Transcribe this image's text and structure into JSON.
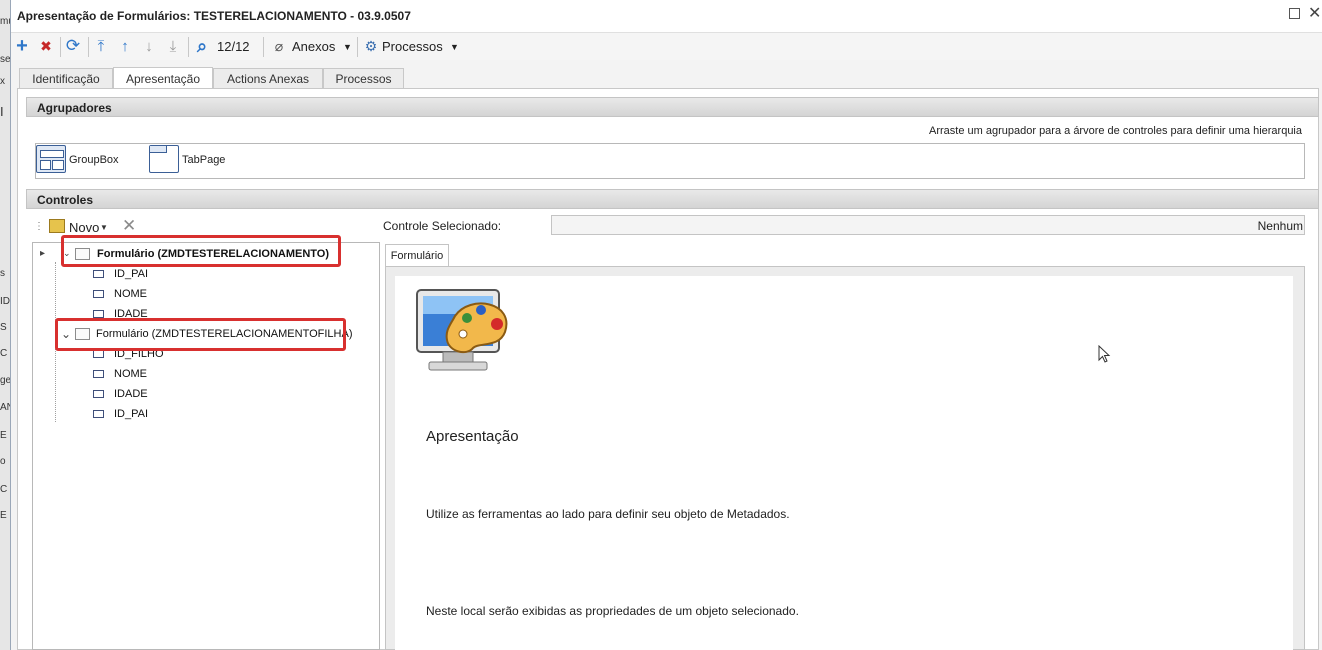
{
  "background_strip": [
    "mu",
    "se",
    "x",
    "I",
    "s",
    "ID",
    "S",
    "C",
    "ge",
    "AN",
    "E",
    "o",
    "C",
    "E"
  ],
  "window": {
    "title": "Apresentação de Formulários: TESTERELACIONAMENTO - 03.9.0507"
  },
  "toolbar": {
    "add": "+",
    "remove": "✖",
    "refresh": "⟳",
    "first": "⤒",
    "up": "↑",
    "down": "↓",
    "last": "⤓",
    "search": "⌕",
    "record_counter": "12/12",
    "attachments_label": "Anexos",
    "processes_label": "Processos",
    "dropdown": "▼"
  },
  "tabs": [
    {
      "label": "Identificação"
    },
    {
      "label": "Apresentação",
      "active": true
    },
    {
      "label": "Actions Anexas"
    },
    {
      "label": "Processos"
    }
  ],
  "agrupadores": {
    "header": "Agrupadores",
    "hint": "Arraste um agrupador para a árvore de controles para definir uma hierarquia",
    "items": [
      {
        "label": "GroupBox"
      },
      {
        "label": "TabPage"
      }
    ]
  },
  "controles": {
    "header": "Controles",
    "new_label": "Novo",
    "delete": "✕",
    "selected_label": "Controle Selecionado:",
    "selected_value": "Nenhum",
    "tree": [
      {
        "label": "Formulário (ZMDTESTERELACIONAMENTO)",
        "bold": true,
        "fields": [
          "ID_PAI",
          "NOME",
          "IDADE"
        ]
      },
      {
        "label": "Formulário (ZMDTESTERELACIONAMENTOFILHA)",
        "bold": false,
        "fields": [
          "ID_FILHO",
          "NOME",
          "IDADE",
          "ID_PAI"
        ]
      }
    ],
    "toggles": {
      "collapsed": "▸",
      "expanded": "⌄"
    }
  },
  "detail": {
    "tab_label": "Formulário",
    "title": "Apresentação",
    "description_1": "Utilize as ferramentas ao lado para definir seu objeto de Metadados.",
    "description_2": "Neste local serão exibidas as propriedades de um objeto selecionado."
  },
  "colors": {
    "highlight": "#d8302f",
    "toolbar_icon": "#2f77c9",
    "danger_icon": "#c62828"
  }
}
